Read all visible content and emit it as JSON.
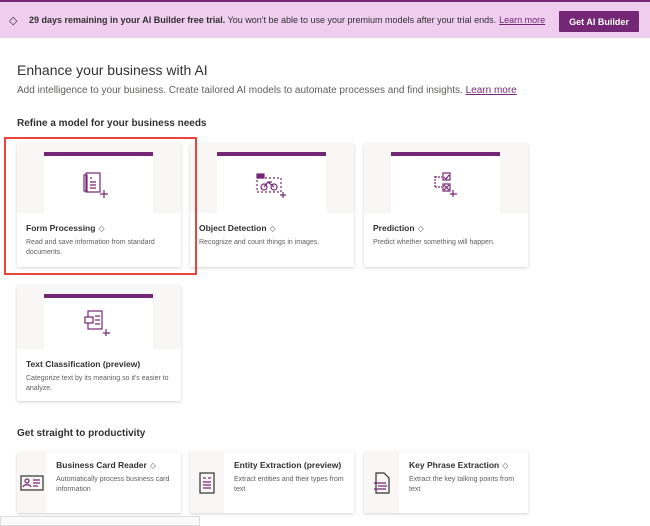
{
  "banner": {
    "bold": "29 days remaining in your AI Builder free trial.",
    "text": "You won't be able to use your premium models after your trial ends.",
    "link": "Learn more",
    "button": "Get AI Builder"
  },
  "page": {
    "title": "Enhance your business with AI",
    "subtitle": "Add intelligence to your business. Create tailored AI models to automate processes and find insights.",
    "subtitle_link": "Learn more",
    "section1": "Refine a model for your business needs",
    "section2": "Get straight to productivity"
  },
  "models": [
    {
      "title": "Form Processing",
      "desc": "Read and save information from standard documents.",
      "premium": true
    },
    {
      "title": "Object Detection",
      "desc": "Recognize and count things in images.",
      "premium": true
    },
    {
      "title": "Prediction",
      "desc": "Predict whether something will happen.",
      "premium": true
    },
    {
      "title": "Text Classification (preview)",
      "desc": "Categorize text by its meaning so it's easier to analyze.",
      "premium": false
    }
  ],
  "prebuilt": [
    {
      "title": "Business Card Reader",
      "desc": "Automatically process business card information",
      "premium": true
    },
    {
      "title": "Entity Extraction (preview)",
      "desc": "Extract entities and their types from text",
      "premium": false
    },
    {
      "title": "Key Phrase Extraction",
      "desc": "Extract the key talking points from text",
      "premium": true
    }
  ],
  "colors": {
    "accent": "#742774",
    "banner": "#efcdee",
    "highlight": "#e8453c"
  }
}
